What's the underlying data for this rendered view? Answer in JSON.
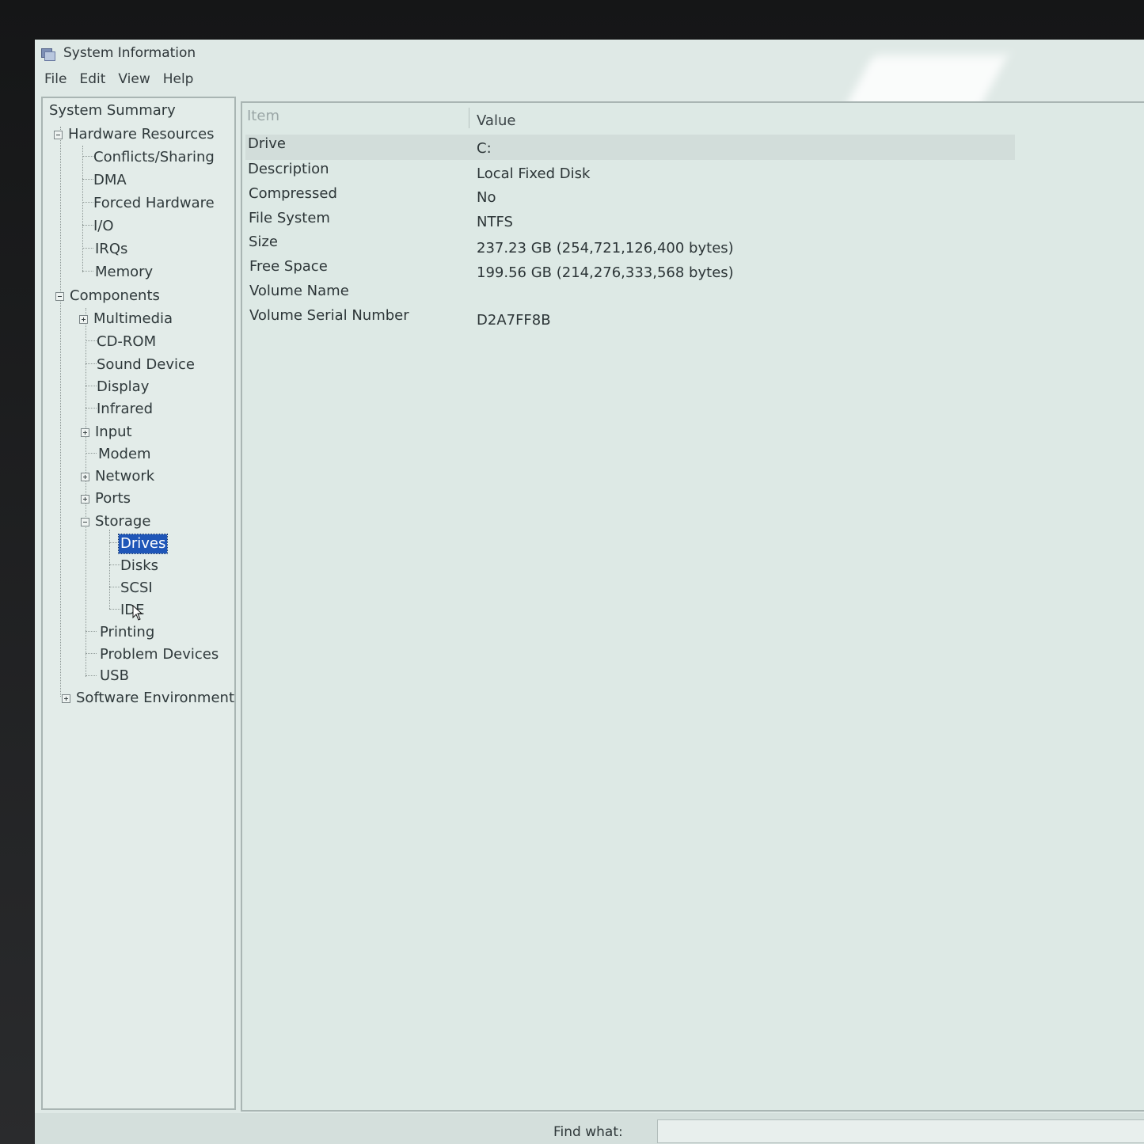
{
  "window": {
    "title": "System Information"
  },
  "menu": [
    "File",
    "Edit",
    "View",
    "Help"
  ],
  "tree": {
    "root": "System Summary",
    "hardware_resources": {
      "label": "Hardware Resources",
      "children": [
        "Conflicts/Sharing",
        "DMA",
        "Forced Hardware",
        "I/O",
        "IRQs",
        "Memory"
      ]
    },
    "components": {
      "label": "Components",
      "children": {
        "multimedia": "Multimedia",
        "cdrom": "CD-ROM",
        "sound": "Sound Device",
        "display": "Display",
        "infrared": "Infrared",
        "input": "Input",
        "modem": "Modem",
        "network": "Network",
        "ports": "Ports",
        "storage": {
          "label": "Storage",
          "children": [
            "Drives",
            "Disks",
            "SCSI",
            "IDE"
          ]
        },
        "printing": "Printing",
        "problem_devices": "Problem Devices",
        "usb": "USB"
      }
    },
    "software_environment": "Software Environment",
    "selected": "Drives"
  },
  "list": {
    "headers": {
      "item": "Item",
      "value": "Value"
    },
    "rows": [
      {
        "item": "Drive",
        "value": "C:"
      },
      {
        "item": "Description",
        "value": "Local Fixed Disk"
      },
      {
        "item": "Compressed",
        "value": "No"
      },
      {
        "item": "File System",
        "value": "NTFS"
      },
      {
        "item": "Size",
        "value": "237.23 GB (254,721,126,400 bytes)"
      },
      {
        "item": "Free Space",
        "value": "199.56 GB (214,276,333,568 bytes)"
      },
      {
        "item": "Volume Name",
        "value": ""
      },
      {
        "item": "Volume Serial Number",
        "value": "D2A7FF8B"
      }
    ]
  },
  "find": {
    "label": "Find what:",
    "value": ""
  },
  "icons": {
    "app": "system-information-icon",
    "collapse": "minus-box-icon",
    "expand": "plus-box-icon",
    "cursor": "mouse-pointer-icon"
  },
  "colors": {
    "selection": "#1f56b8",
    "window_bg": "#dfe9e6"
  }
}
